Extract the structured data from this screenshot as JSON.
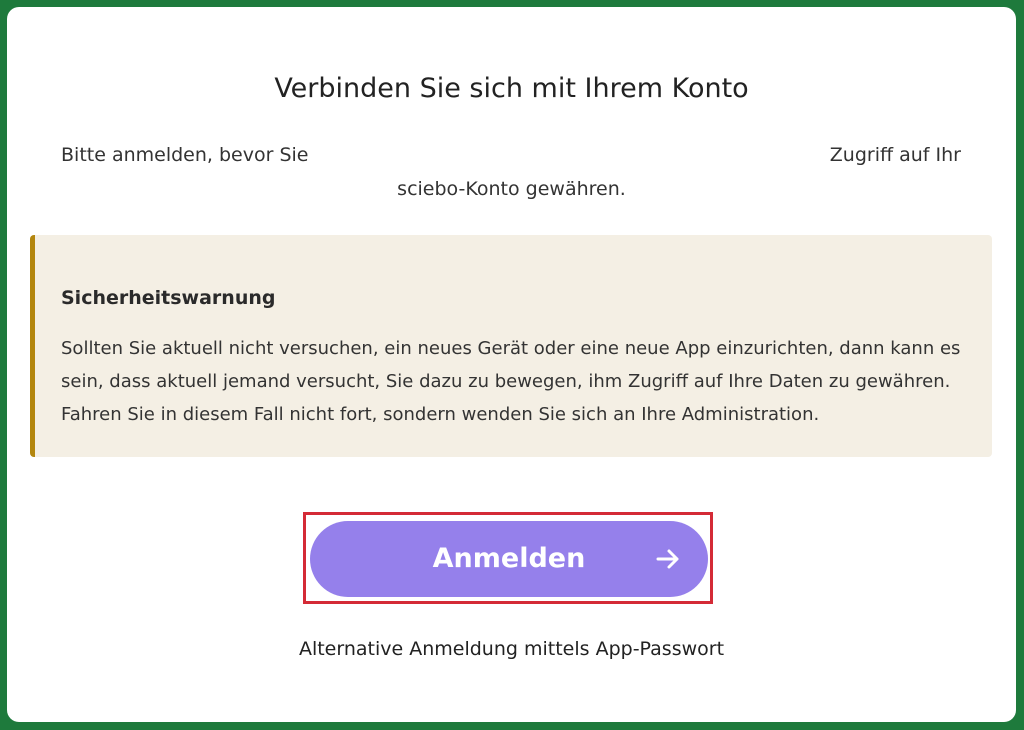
{
  "page": {
    "title": "Verbinden Sie sich mit Ihrem Konto",
    "intro_left": "Bitte anmelden, bevor Sie",
    "intro_right": "Zugriff auf Ihr",
    "intro_line2": "sciebo-Konto gewähren."
  },
  "warning": {
    "title": "Sicherheitswarnung",
    "text": "Sollten Sie aktuell nicht versuchen, ein neues Gerät oder eine neue App einzurichten, dann kann es sein, dass aktuell jemand versucht, Sie dazu zu bewegen, ihm Zugriff auf Ihre Daten zu gewähren. Fahren Sie in diesem Fall nicht fort, sondern wenden Sie sich an Ihre Administration.",
    "accent_color": "#b3860e",
    "background_color": "#f4efe4"
  },
  "login": {
    "button_label": "Anmelden",
    "button_icon": "arrow-right-icon",
    "button_color": "#9580eb",
    "highlight_color": "#d42a36"
  },
  "alternative": {
    "link_label": "Alternative Anmeldung mittels App-Passwort"
  },
  "theme": {
    "frame_color": "#1e7a3c"
  }
}
